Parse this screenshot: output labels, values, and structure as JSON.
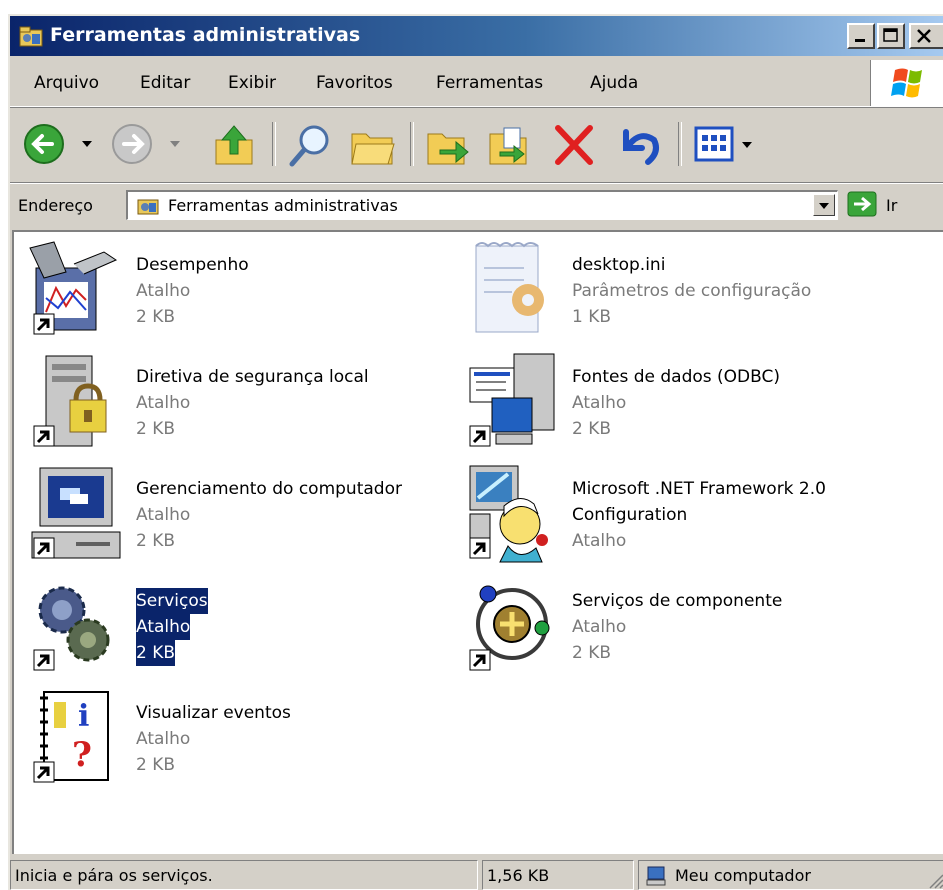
{
  "window": {
    "title": "Ferramentas administrativas"
  },
  "menu": [
    "Arquivo",
    "Editar",
    "Exibir",
    "Favoritos",
    "Ferramentas",
    "Ajuda"
  ],
  "address": {
    "label": "Endereço",
    "value": "Ferramentas administrativas",
    "go_label": "Ir"
  },
  "items": [
    {
      "name": "Desempenho",
      "type": "Atalho",
      "size": "2 KB",
      "icon": "performance-icon"
    },
    {
      "name": "desktop.ini",
      "type": "Parâmetros de configuração",
      "size": "1 KB",
      "icon": "config-file-icon"
    },
    {
      "name": "Diretiva de segurança local",
      "type": "Atalho",
      "size": "2 KB",
      "icon": "security-policy-icon"
    },
    {
      "name": "Fontes de dados (ODBC)",
      "type": "Atalho",
      "size": "2 KB",
      "icon": "odbc-icon"
    },
    {
      "name": "Gerenciamento do computador",
      "type": "Atalho",
      "size": "2 KB",
      "icon": "computer-management-icon"
    },
    {
      "name": "Microsoft .NET Framework 2.0",
      "name2": "Configuration",
      "type": "Atalho",
      "icon": "dotnet-config-icon"
    },
    {
      "name": "Serviços",
      "type": "Atalho",
      "size": "2 KB",
      "icon": "services-icon",
      "selected": true
    },
    {
      "name": "Serviços de componente",
      "type": "Atalho",
      "size": "2 KB",
      "icon": "component-services-icon"
    },
    {
      "name": "Visualizar eventos",
      "type": "Atalho",
      "size": "2 KB",
      "icon": "event-viewer-icon"
    }
  ],
  "status": {
    "message": "Inicia e pára os serviços.",
    "size": "1,56 KB",
    "zone": "Meu computador"
  }
}
